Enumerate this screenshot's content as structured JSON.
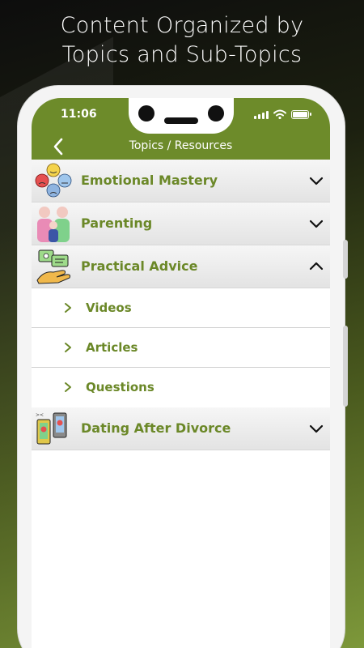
{
  "headline": {
    "line1": "Content Organized by",
    "line2": "Topics and Sub-Topics"
  },
  "status_bar": {
    "time": "11:06",
    "icons": [
      "signal-icon",
      "wifi-icon",
      "battery-icon"
    ]
  },
  "nav": {
    "title": "Topics / Resources",
    "back_icon": "chevron-left-icon"
  },
  "topics": [
    {
      "label": "Emotional Mastery",
      "icon": "emotion-faces-icon",
      "expanded": false
    },
    {
      "label": "Parenting",
      "icon": "family-icon",
      "expanded": false
    },
    {
      "label": "Practical Advice",
      "icon": "advice-hand-icon",
      "expanded": true,
      "subtopics": [
        {
          "label": "Videos"
        },
        {
          "label": "Articles"
        },
        {
          "label": "Questions"
        }
      ]
    },
    {
      "label": "Dating After Divorce",
      "icon": "dating-phones-icon",
      "expanded": false
    }
  ],
  "colors": {
    "brand_green": "#6d8b2a",
    "label_green": "#6b8828",
    "row_gray": "#e8e8e8"
  }
}
